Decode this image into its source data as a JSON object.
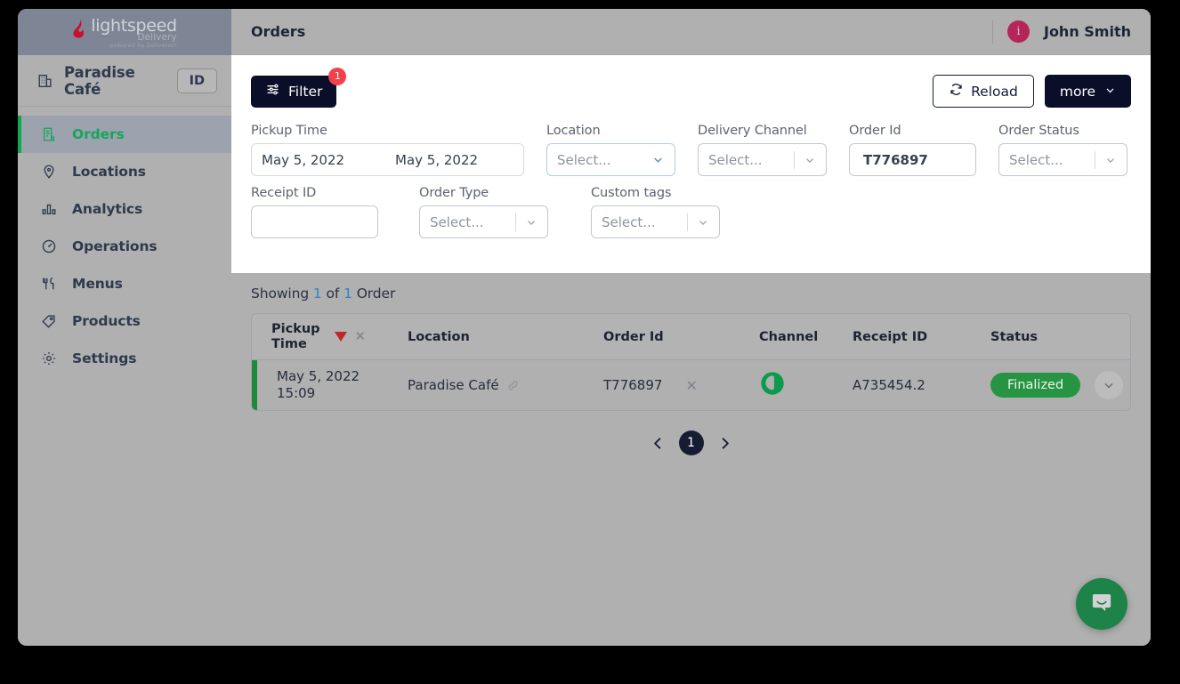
{
  "sidebar": {
    "logo": {
      "icon": "lightspeed-flame-icon",
      "name": "lightspeed",
      "product": "Delivery",
      "tagline": "powered by Deliverect"
    },
    "store": {
      "icon": "store-building-icon",
      "name": "Paradise Café",
      "id_badge": "ID"
    },
    "items": [
      {
        "label": "Orders",
        "icon": "orders-receipt-icon",
        "active": true
      },
      {
        "label": "Locations",
        "icon": "map-pin-icon",
        "active": false
      },
      {
        "label": "Analytics",
        "icon": "bar-chart-icon",
        "active": false
      },
      {
        "label": "Operations",
        "icon": "gauge-icon",
        "active": false
      },
      {
        "label": "Menus",
        "icon": "cutlery-icon",
        "active": false
      },
      {
        "label": "Products",
        "icon": "tag-icon",
        "active": false
      },
      {
        "label": "Settings",
        "icon": "gear-icon",
        "active": false
      }
    ]
  },
  "topbar": {
    "title": "Orders",
    "avatar_letter": "i",
    "avatar_color": "#b5255a",
    "user_name": "John Smith"
  },
  "toolbar": {
    "filter_label": "Filter",
    "filter_icon": "sliders-icon",
    "filter_badge": "1",
    "reload_label": "Reload",
    "reload_icon": "refresh-icon",
    "more_label": "more",
    "more_icon": "chevron-down-icon"
  },
  "filters": {
    "pickup_time": {
      "label": "Pickup Time",
      "from_value": "May 5, 2022",
      "to_value": "May 5, 2022"
    },
    "location": {
      "label": "Location",
      "placeholder": "Select..."
    },
    "delivery_channel": {
      "label": "Delivery Channel",
      "placeholder": "Select..."
    },
    "order_id": {
      "label": "Order Id",
      "value": "T776897"
    },
    "order_status": {
      "label": "Order Status",
      "placeholder": "Select..."
    },
    "receipt_id": {
      "label": "Receipt ID",
      "value": ""
    },
    "order_type": {
      "label": "Order Type",
      "placeholder": "Select..."
    },
    "custom_tags": {
      "label": "Custom tags",
      "placeholder": "Select..."
    }
  },
  "results": {
    "showing_prefix": "Showing",
    "showing_count": "1",
    "showing_of": "of",
    "showing_total": "1",
    "showing_suffix": "Order",
    "columns": {
      "pickup_time_line1": "Pickup",
      "pickup_time_line2": "Time",
      "location": "Location",
      "order_id": "Order Id",
      "channel": "Channel",
      "receipt_id": "Receipt ID",
      "status": "Status"
    },
    "sort": {
      "direction_icon": "sort-descending-triangle-icon",
      "clear_icon": "clear-sort-x-icon",
      "color": "#c0272d"
    },
    "rows": [
      {
        "pickup_date": "May 5, 2022",
        "pickup_time": "15:09",
        "location": "Paradise Café",
        "location_link_icon": "link-icon",
        "order_id": "T776897",
        "order_id_clear_icon": "clear-x-icon",
        "channel_icon": "deliverect-channel-icon",
        "channel_color": "#0a9b4b",
        "receipt_id": "A735454.2",
        "status": "Finalized",
        "status_color": "#279444",
        "expand_icon": "chevron-down-icon",
        "accent_color": "#1f8a3b"
      }
    ]
  },
  "pagination": {
    "prev_icon": "chevron-left-icon",
    "current_page": "1",
    "next_icon": "chevron-right-icon"
  },
  "chat": {
    "icon": "intercom-chat-icon",
    "color": "#1d8348"
  }
}
